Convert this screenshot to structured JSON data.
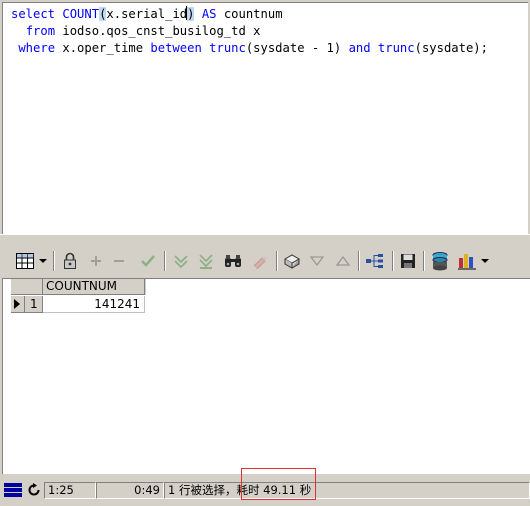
{
  "editor": {
    "line1": {
      "k1": "select",
      "t1": " ",
      "k2": "COUNT",
      "p1": "(",
      "t2": "x.serial_id",
      "p2": ")",
      "t3": " ",
      "k3": "AS",
      "t4": " countnum"
    },
    "line2": {
      "ind": "  ",
      "k1": "from",
      "t1": " iodso.qos_cnst_busilog_td x"
    },
    "line3": {
      "ind": " ",
      "k1": "where",
      "t1": " x.oper_time ",
      "k2": "between",
      "t2": " ",
      "k3": "trunc",
      "t3": "(sysdate - 1) ",
      "k4": "and",
      "t4": " ",
      "k5": "trunc",
      "t5": "(sysdate);"
    }
  },
  "toolbar": {
    "icons": [
      "grid-view-icon",
      "dropdown-arrow-icon",
      "lock-icon",
      "insert-record-icon",
      "delete-record-icon",
      "post-changes-icon",
      "fetch-next-page-icon",
      "fetch-last-page-icon",
      "query-by-example-icon",
      "clear-record-icon",
      "single-record-view-icon",
      "next-record-icon",
      "previous-record-icon",
      "query-plan-icon",
      "save-results-icon",
      "export-query-results-icon",
      "chart-icon",
      "chart-dropdown-arrow-icon"
    ]
  },
  "grid": {
    "columns": [
      "COUNTNUM"
    ],
    "rows": [
      {
        "num": "1",
        "countnum": "141241"
      }
    ]
  },
  "status": {
    "cursor_pos": "1:25",
    "elapsed": "0:49",
    "message": "1 行被选择，耗时 49.11 秒"
  },
  "colors": {
    "keyword": "#0000ff",
    "highlight_box": "#e03030"
  }
}
